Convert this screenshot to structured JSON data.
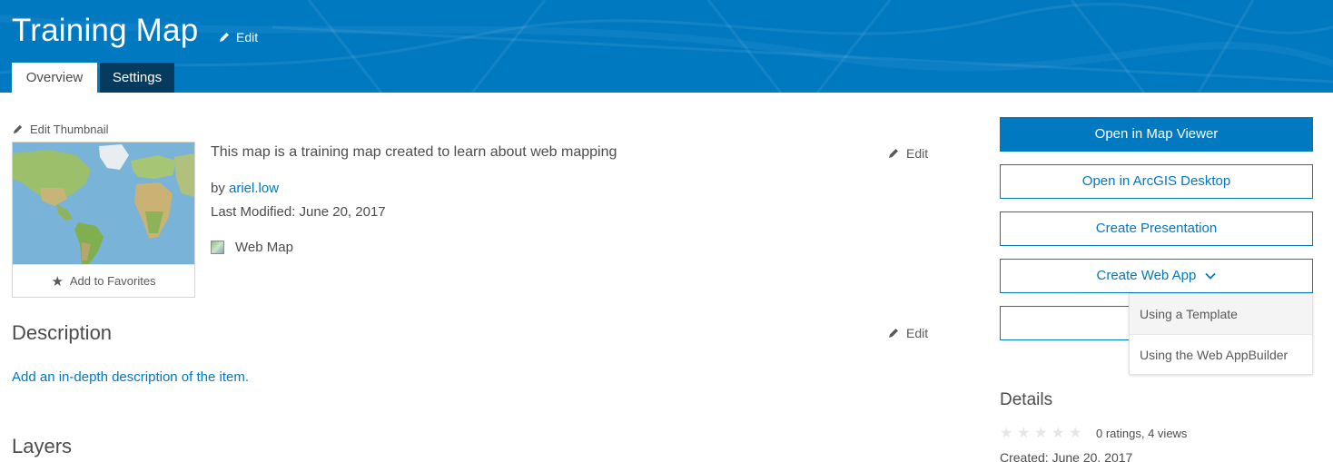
{
  "header": {
    "title": "Training Map",
    "edit_label": "Edit",
    "tabs": [
      {
        "label": "Overview",
        "active": true
      },
      {
        "label": "Settings",
        "active": false
      }
    ]
  },
  "thumbnail": {
    "edit_label": "Edit Thumbnail",
    "favorites_label": "Add to Favorites"
  },
  "summary": {
    "text": "This map is a training map created to learn about web mapping",
    "edit_label": "Edit",
    "by_prefix": "by",
    "owner": "ariel.low",
    "last_modified": "Last Modified: June 20, 2017",
    "item_type": "Web Map"
  },
  "description": {
    "title": "Description",
    "edit_label": "Edit",
    "link": "Add an in-depth description of the item."
  },
  "layers": {
    "title": "Layers"
  },
  "actions": {
    "open_map_viewer": "Open in Map Viewer",
    "open_desktop": "Open in ArcGIS Desktop",
    "create_presentation": "Create Presentation",
    "create_web_app": "Create Web App",
    "web_app_menu": [
      "Using a Template",
      "Using the Web AppBuilder"
    ]
  },
  "details": {
    "title": "Details",
    "rating_stars": 0,
    "rating_text": "0 ratings, 4 views",
    "created": "Created: June 20, 2017"
  },
  "colors": {
    "brand_blue": "#0079c1",
    "dark_tab": "#053b5e",
    "text": "#4c4c4c"
  }
}
